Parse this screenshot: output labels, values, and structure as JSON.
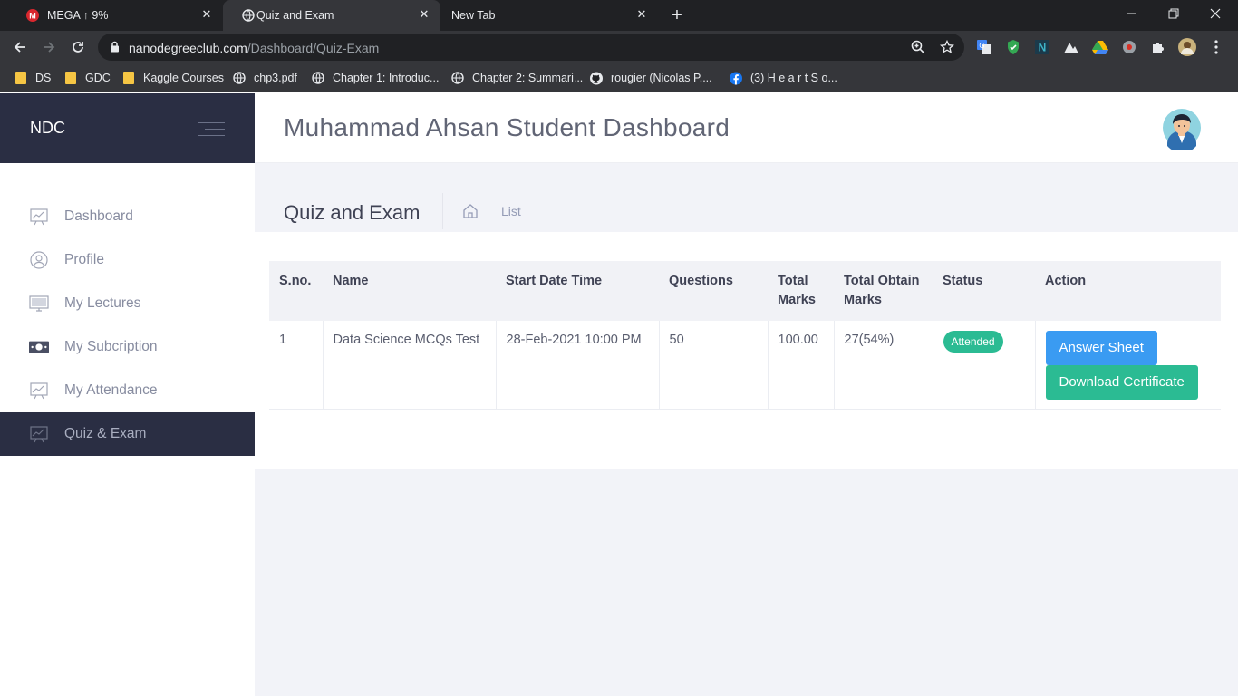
{
  "browser": {
    "tabs": [
      {
        "label": "MEGA ↑ 9%",
        "icon": "mega-icon",
        "active": false
      },
      {
        "label": "Quiz and Exam",
        "icon": "globe-icon",
        "active": true
      },
      {
        "label": "New Tab",
        "icon": "",
        "active": false
      }
    ],
    "url_host": "nanodegreeclub.com",
    "url_path": "/Dashboard/Quiz-Exam",
    "bookmarks": [
      {
        "label": "DS",
        "icon": "folder-icon"
      },
      {
        "label": "GDC",
        "icon": "folder-icon"
      },
      {
        "label": "Kaggle Courses",
        "icon": "folder-icon"
      },
      {
        "label": "chp3.pdf",
        "icon": "globe-icon"
      },
      {
        "label": "Chapter 1: Introduc...",
        "icon": "globe-icon"
      },
      {
        "label": "Chapter 2: Summari...",
        "icon": "globe-icon"
      },
      {
        "label": "rougier (Nicolas P....",
        "icon": "github-icon"
      },
      {
        "label": "(3) H e a r t  S o...",
        "icon": "facebook-icon"
      }
    ]
  },
  "brand": {
    "logo": "NDC"
  },
  "sidebar": {
    "items": [
      {
        "label": "Dashboard",
        "icon": "chart-board-icon",
        "active": false
      },
      {
        "label": "Profile",
        "icon": "user-circle-icon",
        "active": false
      },
      {
        "label": "My Lectures",
        "icon": "monitor-icon",
        "active": false
      },
      {
        "label": "My Subcription",
        "icon": "money-icon",
        "active": false
      },
      {
        "label": "My Attendance",
        "icon": "chart-board-icon",
        "active": false
      },
      {
        "label": "Quiz & Exam",
        "icon": "chart-board-icon",
        "active": true
      }
    ]
  },
  "header": {
    "title": "Muhammad Ahsan Student Dashboard"
  },
  "subheader": {
    "title": "Quiz and Exam",
    "breadcrumb": "List"
  },
  "table": {
    "headers": [
      "S.no.",
      "Name",
      "Start Date Time",
      "Questions",
      "Total Marks",
      "Total Obtain Marks",
      "Status",
      "Action"
    ],
    "rows": [
      {
        "sno": "1",
        "name": "Data Science MCQs Test",
        "start": "28-Feb-2021 10:00 PM",
        "questions": "50",
        "total_marks": "100.00",
        "obtained": "27(54%)",
        "status": "Attended",
        "actions": [
          "Answer Sheet",
          "Download Certificate"
        ]
      }
    ]
  },
  "colors": {
    "sidebar_dark": "#2a2e43",
    "badge_green": "#2bbb93",
    "button_blue": "#3a9bf2"
  }
}
